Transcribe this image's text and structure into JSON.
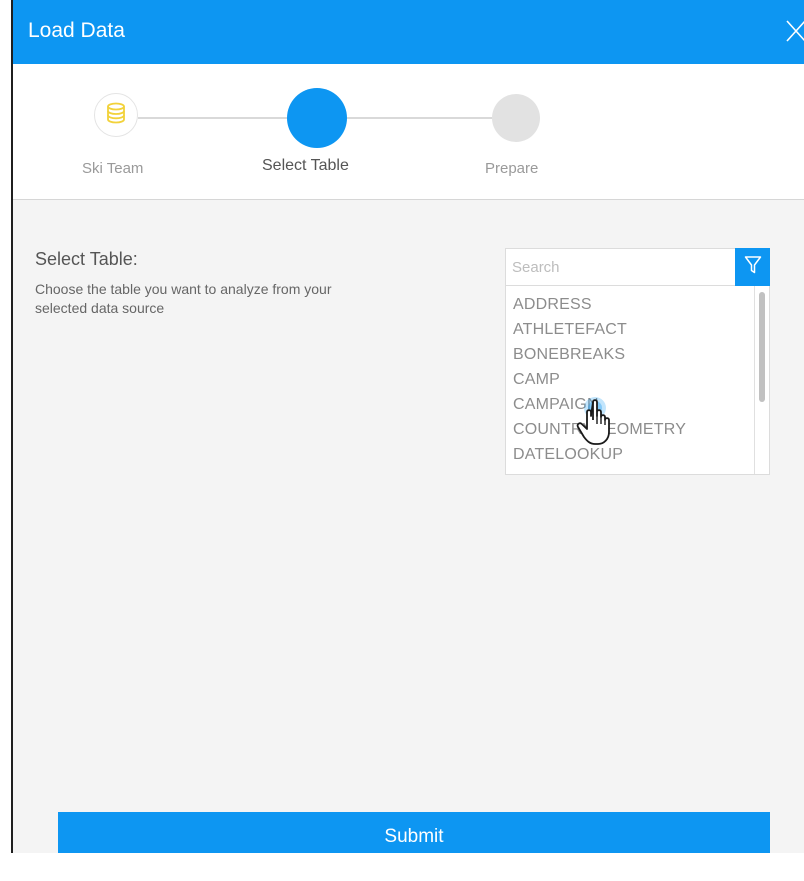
{
  "dialog": {
    "title": "Load Data"
  },
  "stepper": {
    "steps": [
      {
        "label": "Ski Team",
        "state": "completed",
        "icon": "database-icon"
      },
      {
        "label": "Select Table",
        "state": "active"
      },
      {
        "label": "Prepare",
        "state": "pending"
      }
    ]
  },
  "select_table": {
    "heading": "Select Table:",
    "description": "Choose the table you want to analyze from your selected data source"
  },
  "search": {
    "placeholder": "Search",
    "value": "",
    "filter_icon": "filter-icon"
  },
  "tables": [
    "ADDRESS",
    "ATHLETEFACT",
    "BONEBREAKS",
    "CAMP",
    "CAMPAIGN",
    "COUNTRYGEOMETRY",
    "DATELOOKUP"
  ],
  "actions": {
    "submit_label": "Submit"
  },
  "colors": {
    "accent": "#0d96f2",
    "step_pending": "#e2e2e2",
    "database_icon": "#f2d23a"
  }
}
